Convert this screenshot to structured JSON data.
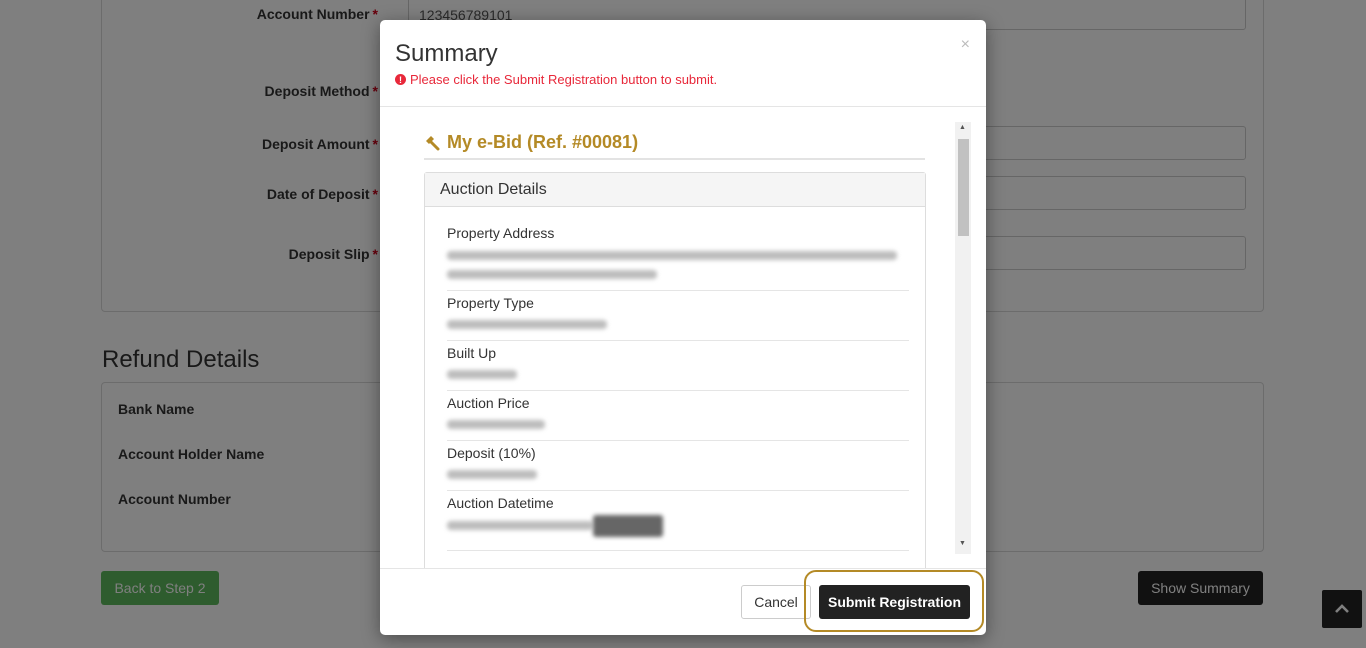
{
  "form": {
    "account_number_label": "Account Number",
    "account_number_value": "123456789101",
    "deposit_method_label": "Deposit Method",
    "deposit_amount_label": "Deposit Amount",
    "date_of_deposit_label": "Date of Deposit",
    "deposit_slip_label": "Deposit Slip",
    "required_mark": "*"
  },
  "refund": {
    "title": "Refund Details",
    "bank_name_label": "Bank Name",
    "account_holder_label": "Account Holder Name",
    "account_number_label": "Account Number"
  },
  "footer": {
    "back_button": "Back to Step 2",
    "show_summary_button": "Show Summary"
  },
  "modal": {
    "title": "Summary",
    "close": "×",
    "warning": "Please click the Submit Registration button to submit.",
    "bid_title": "My e-Bid (Ref. #00081)",
    "section_title": "Auction Details",
    "fields": [
      {
        "label": "Property Address"
      },
      {
        "label": "Property Type"
      },
      {
        "label": "Built Up"
      },
      {
        "label": "Auction Price"
      },
      {
        "label": "Deposit (10%)"
      },
      {
        "label": "Auction Datetime"
      }
    ],
    "cancel_button": "Cancel",
    "submit_button": "Submit Registration"
  },
  "colors": {
    "gold": "#b48a26",
    "warning_red": "#e8283a",
    "back_green": "#5cb85c",
    "dark_button": "#222222",
    "highlight_ring": "#b48a26"
  },
  "icons": {
    "bid_icon": "gavel-icon",
    "warning_icon": "exclamation-circle-icon",
    "scroll_top_icon": "chevron-up-icon"
  }
}
